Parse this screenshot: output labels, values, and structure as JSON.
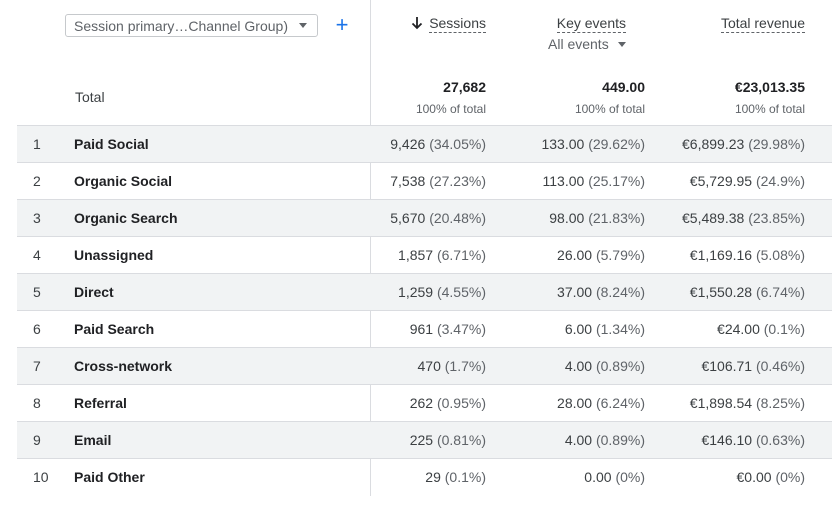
{
  "dimension_selector": {
    "value": "Session primary…Channel Group)"
  },
  "add_dimension": {
    "label": "+"
  },
  "columns": {
    "sessions": {
      "label": "Sessions"
    },
    "key_events": {
      "label": "Key events",
      "filter": "All events"
    },
    "revenue": {
      "label": "Total revenue"
    }
  },
  "totals": {
    "label": "Total",
    "sessions": "27,682",
    "sessions_pct": "100% of total",
    "key_events": "449.00",
    "key_events_pct": "100% of total",
    "revenue": "€23,013.35",
    "revenue_pct": "100% of total"
  },
  "rows": [
    {
      "idx": "1",
      "name": "Paid Social",
      "sessions": "9,426",
      "sessions_pct": "(34.05%)",
      "key_events": "133.00",
      "key_events_pct": "(29.62%)",
      "revenue": "€6,899.23",
      "revenue_pct": "(29.98%)"
    },
    {
      "idx": "2",
      "name": "Organic Social",
      "sessions": "7,538",
      "sessions_pct": "(27.23%)",
      "key_events": "113.00",
      "key_events_pct": "(25.17%)",
      "revenue": "€5,729.95",
      "revenue_pct": "(24.9%)"
    },
    {
      "idx": "3",
      "name": "Organic Search",
      "sessions": "5,670",
      "sessions_pct": "(20.48%)",
      "key_events": "98.00",
      "key_events_pct": "(21.83%)",
      "revenue": "€5,489.38",
      "revenue_pct": "(23.85%)"
    },
    {
      "idx": "4",
      "name": "Unassigned",
      "sessions": "1,857",
      "sessions_pct": "(6.71%)",
      "key_events": "26.00",
      "key_events_pct": "(5.79%)",
      "revenue": "€1,169.16",
      "revenue_pct": "(5.08%)"
    },
    {
      "idx": "5",
      "name": "Direct",
      "sessions": "1,259",
      "sessions_pct": "(4.55%)",
      "key_events": "37.00",
      "key_events_pct": "(8.24%)",
      "revenue": "€1,550.28",
      "revenue_pct": "(6.74%)"
    },
    {
      "idx": "6",
      "name": "Paid Search",
      "sessions": "961",
      "sessions_pct": "(3.47%)",
      "key_events": "6.00",
      "key_events_pct": "(1.34%)",
      "revenue": "€24.00",
      "revenue_pct": "(0.1%)"
    },
    {
      "idx": "7",
      "name": "Cross-network",
      "sessions": "470",
      "sessions_pct": "(1.7%)",
      "key_events": "4.00",
      "key_events_pct": "(0.89%)",
      "revenue": "€106.71",
      "revenue_pct": "(0.46%)"
    },
    {
      "idx": "8",
      "name": "Referral",
      "sessions": "262",
      "sessions_pct": "(0.95%)",
      "key_events": "28.00",
      "key_events_pct": "(6.24%)",
      "revenue": "€1,898.54",
      "revenue_pct": "(8.25%)"
    },
    {
      "idx": "9",
      "name": "Email",
      "sessions": "225",
      "sessions_pct": "(0.81%)",
      "key_events": "4.00",
      "key_events_pct": "(0.89%)",
      "revenue": "€146.10",
      "revenue_pct": "(0.63%)"
    },
    {
      "idx": "10",
      "name": "Paid Other",
      "sessions": "29",
      "sessions_pct": "(0.1%)",
      "key_events": "0.00",
      "key_events_pct": "(0%)",
      "revenue": "€0.00",
      "revenue_pct": "(0%)"
    }
  ],
  "colors": {
    "accent": "#1a73e8",
    "shade": "#f1f3f4",
    "divider": "#dadce0"
  }
}
